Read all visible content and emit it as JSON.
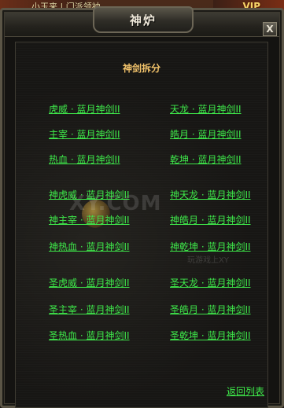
{
  "background": {
    "top_left_text": "小玉来 | 门派领袖",
    "vip_label": "VIP"
  },
  "window": {
    "title": "神炉",
    "close_label": "X"
  },
  "section": {
    "title": "神剑拆分"
  },
  "links": {
    "row1_left": "虎威 · 蓝月神剑II",
    "row1_right": "天龙 · 蓝月神剑II",
    "row2_left": "主宰 · 蓝月神剑II",
    "row2_right": "皓月 · 蓝月神剑II",
    "row3_left": "热血 · 蓝月神剑II",
    "row3_right": "乾坤 · 蓝月神剑II",
    "row4_left": "神虎威 · 蓝月神剑II",
    "row4_right": "神天龙 · 蓝月神剑II",
    "row5_left": "神主宰 · 蓝月神剑II",
    "row5_right": "神皓月 · 蓝月神剑II",
    "row6_left": "神热血 · 蓝月神剑II",
    "row6_right": "神乾坤 · 蓝月神剑II",
    "row7_left": "圣虎威 · 蓝月神剑II",
    "row7_right": "圣天龙 · 蓝月神剑II",
    "row8_left": "圣主宰 · 蓝月神剑II",
    "row8_right": "圣皓月 · 蓝月神剑II",
    "row9_left": "圣热血 · 蓝月神剑II",
    "row9_right": "圣乾坤 · 蓝月神剑II"
  },
  "watermark": {
    "logo": "XY.COM",
    "small": "玩游戏上XY"
  },
  "footer": {
    "back_label": "返回列表"
  },
  "colors": {
    "link": "#3ee84a",
    "section_title": "#f2c36b",
    "panel": "#171614"
  }
}
